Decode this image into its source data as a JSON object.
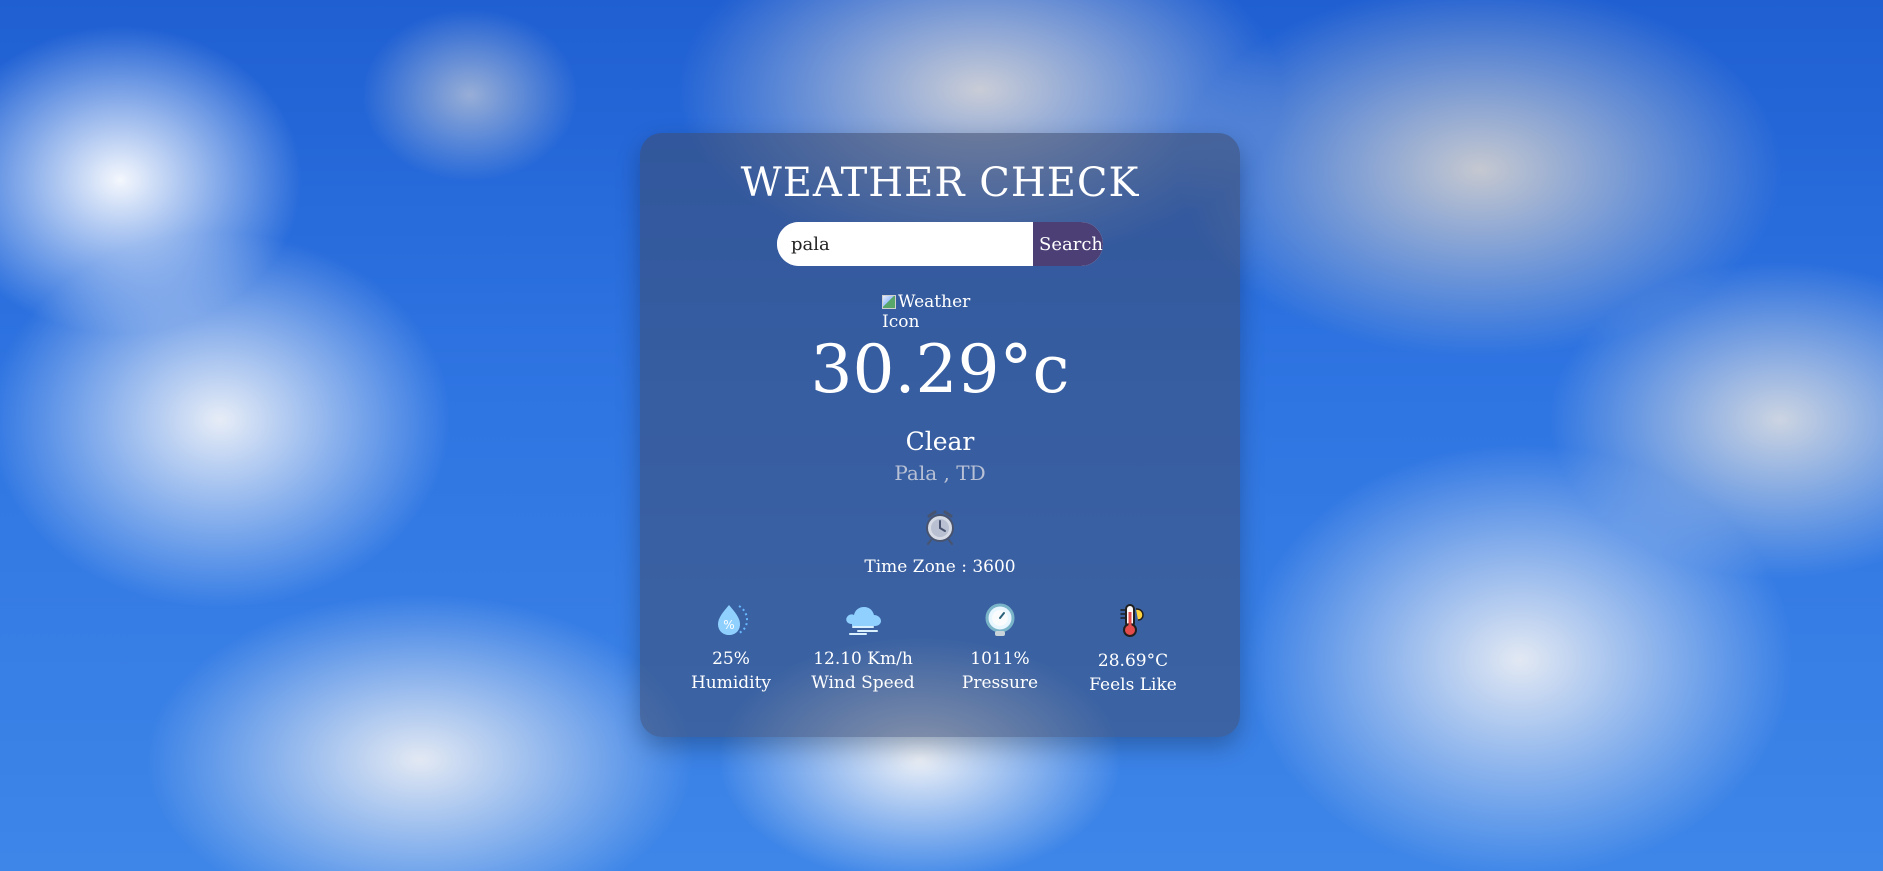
{
  "app": {
    "title": "WEATHER CHECK"
  },
  "search": {
    "value": "pala",
    "button_label": "Search"
  },
  "weather_icon": {
    "alt_text": "Weather Icon"
  },
  "current": {
    "temperature": "30.29°c",
    "condition": "Clear",
    "location": "Pala , TD",
    "timezone": "Time Zone : 3600"
  },
  "stats": [
    {
      "value": "25%",
      "label": "Humidity",
      "icon": "humidity-icon"
    },
    {
      "value": "12.10 Km/h",
      "label": "Wind Speed",
      "icon": "wind-icon"
    },
    {
      "value": "1011%",
      "label": "Pressure",
      "icon": "pressure-gauge-icon"
    },
    {
      "value": "28.69°C",
      "label": "Feels Like",
      "icon": "thermometer-icon"
    }
  ],
  "colors": {
    "search_button": "#4b3f76",
    "card_overlay": "#3e4a6c",
    "sky": "#2f75e2"
  }
}
